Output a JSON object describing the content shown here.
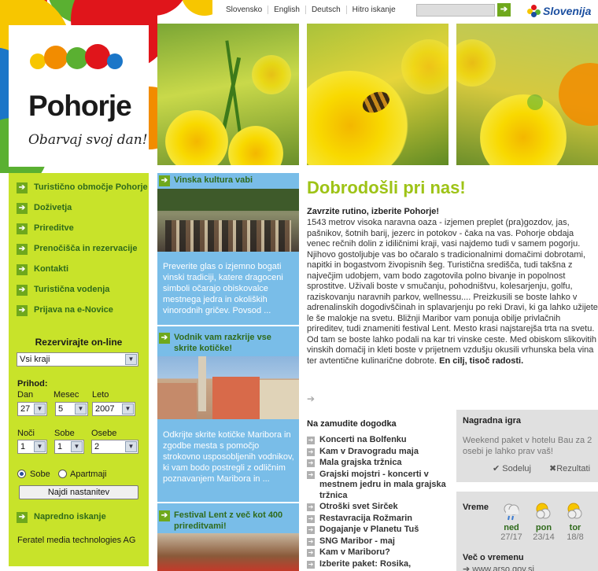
{
  "topbar": {
    "links": [
      "Slovensko",
      "English",
      "Deutsch",
      "Hitro iskanje"
    ],
    "search_go": "➔",
    "brand": "Slovenija"
  },
  "logo": {
    "title": "Pohorje",
    "slogan": "Obarvaj svoj dan!"
  },
  "nav": [
    "Turistično območje Pohorje",
    "Doživetja",
    "Prireditve",
    "Prenočišča in rezervacije",
    "Kontakti",
    "Turistična vodenja",
    "Prijava na e-Novice"
  ],
  "booking": {
    "heading": "Rezervirajte on-line",
    "region": "Vsi kraji",
    "arrival_label": "Prihod:",
    "day_label": "Dan",
    "month_label": "Mesec",
    "year_label": "Leto",
    "day": "27",
    "month": "5",
    "year": "2007",
    "nights_label": "Noči",
    "rooms_label": "Sobe",
    "persons_label": "Osebe",
    "nights": "1",
    "rooms": "1",
    "persons": "2",
    "radio_rooms": "Sobe",
    "radio_apartments": "Apartmaji",
    "find_button": "Najdi nastanitev",
    "advanced": "Napredno iskanje",
    "provider": "Feratel media technologies AG"
  },
  "features": [
    {
      "title": "Vinska kultura vabi",
      "text": "Preverite glas o izjemno bogati vinski tradiciji, katere dragoceni simboli očarajo obiskovalce mestnega jedra in okoliških vinorodnih gričev. Povsod ..."
    },
    {
      "title": "Vodnik vam razkrije vse skrite kotičke!",
      "text": "Odkrijte skrite kotičke Maribora in zgodbe mesta s pomočjo strokovno usposobljenih vodnikov, ki vam bodo postregli z odličnim poznavanjem Maribora in ..."
    },
    {
      "title": "Festival Lent z več kot 400 prireditvami!"
    }
  ],
  "welcome": {
    "title": "Dobrodošli pri nas!",
    "lead": "Zavrzite rutino, izberite Pohorje!",
    "body": "1543 metrov visoka naravna oaza - izjemen preplet (pra)gozdov, jas, pašnikov, šotnih barij, jezerc in potokov - čaka na vas. Pohorje obdaja venec rečnih dolin z idiličnimi kraji, vasi najdemo tudi v samem pogorju. Njihovo gostoljubje vas bo očaralo s tradicionalnimi domačimi dobrotami, napitki in bogastvom živopisnih šeg. Turistična središča, tudi takšna z največjim udobjem, vam bodo zagotovila polno bivanje in popolnost sprostitve. Uživali boste v smučanju, pohodništvu, kolesarjenju, golfu, raziskovanju naravnih parkov, wellnessu.... Preizkusili se boste lahko v adrenalinskih dogodivščinah in splavarjenju po reki Dravi, ki ga lahko užijete le še malokje na svetu. Bližnji Maribor vam ponuja obilje privlačnih prireditev, tudi znameniti festival Lent. Mesto krasi najstarejša trta na svetu. Od tam se boste lahko podali na kar tri vinske ceste. Med obiskom slikovitih vinskih domačij in kleti boste v prijetnem vzdušju okusili vrhunska bela vina ter avtentične kulinarične dobrote.",
    "closing": "En cilj, tisoč radosti."
  },
  "events": {
    "heading": "Na zamudite dogodka",
    "items": [
      "Koncerti na Bolfenku",
      "Kam v Dravogradu maja",
      "Mala grajska tržnica",
      "Grajski mojstri - koncerti v mestnem jedru in mala grajska tržnica",
      "Otroški svet Sirček",
      "Restavracija Rožmarin",
      "Dogajanje v Planetu Tuš",
      "SNG Maribor - maj",
      "Kam v Mariboru?",
      "Izberite paket: Rosika,"
    ]
  },
  "prize": {
    "heading": "Nagradna igra",
    "text": "Weekend paket v hotelu Bau za 2 osebi je lahko prav vaš!",
    "participate": "Sodeluj",
    "results": "Rezultati"
  },
  "weather": {
    "heading": "Vreme",
    "days": [
      {
        "day": "ned",
        "date": "27/17"
      },
      {
        "day": "pon",
        "date": "23/14"
      },
      {
        "day": "tor",
        "date": "18/8"
      }
    ],
    "more": "Več o vremenu",
    "link": "www.arso.gov.si"
  },
  "colors": {
    "lime": "#c8e32a",
    "nav_green": "#2f6a1b",
    "title_green": "#9ec316",
    "sky": "#79bde8"
  }
}
